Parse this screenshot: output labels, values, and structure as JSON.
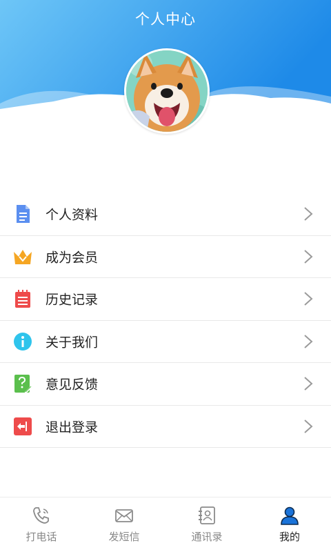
{
  "header": {
    "title": "个人中心"
  },
  "colors": {
    "header_gradient_start": "#6ec6f7",
    "header_gradient_end": "#1e8ae8",
    "tab_inactive": "#888888",
    "tab_active": "#222222",
    "tab_active_icon": "#1a73d9"
  },
  "menu": {
    "items": [
      {
        "label": "个人资料",
        "icon": "document-icon",
        "color": "#5b8ff0"
      },
      {
        "label": "成为会员",
        "icon": "crown-icon",
        "color": "#f5a623"
      },
      {
        "label": "历史记录",
        "icon": "notebook-icon",
        "color": "#ee4b4b"
      },
      {
        "label": "关于我们",
        "icon": "info-icon",
        "color": "#2fc4ec"
      },
      {
        "label": "意见反馈",
        "icon": "feedback-icon",
        "color": "#5bbf4d"
      },
      {
        "label": "退出登录",
        "icon": "logout-icon",
        "color": "#ee4b4b"
      }
    ]
  },
  "tabbar": {
    "tabs": [
      {
        "label": "打电话",
        "icon": "phone-icon",
        "active": false
      },
      {
        "label": "发短信",
        "icon": "envelope-icon",
        "active": false
      },
      {
        "label": "通讯录",
        "icon": "contacts-icon",
        "active": false
      },
      {
        "label": "我的",
        "icon": "person-icon",
        "active": true
      }
    ]
  }
}
